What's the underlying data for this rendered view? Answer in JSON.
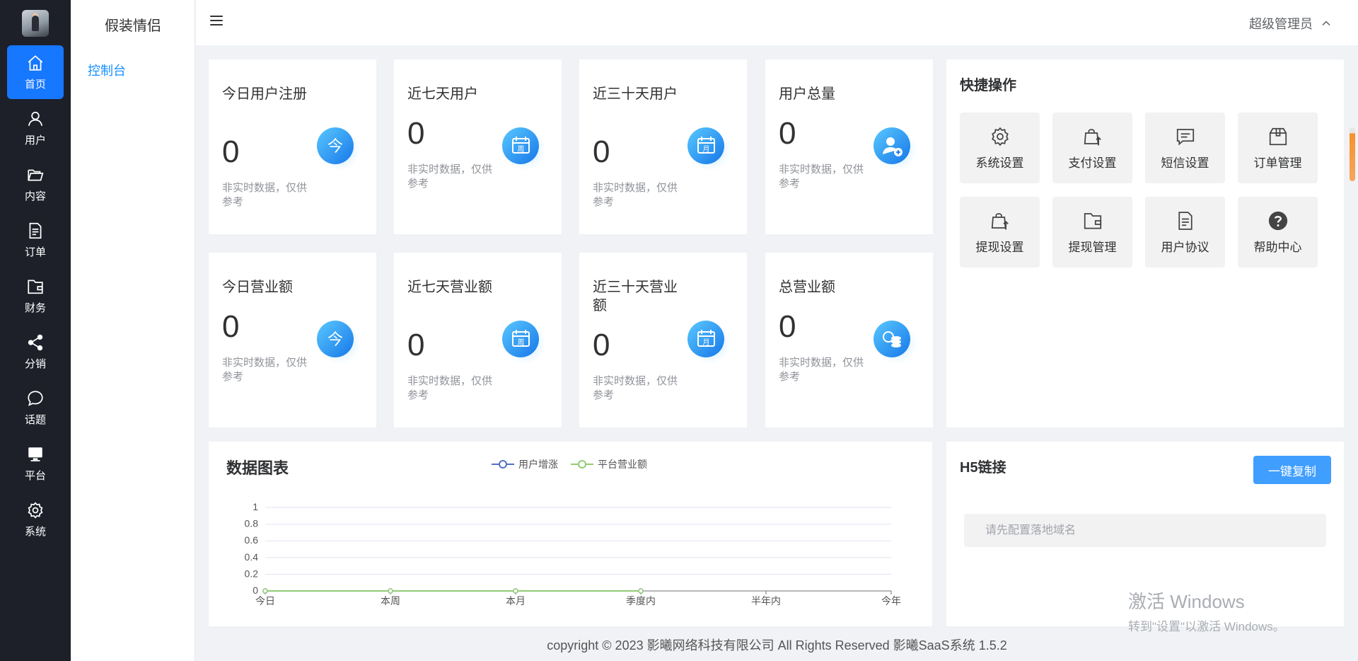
{
  "app": {
    "name": "假装情侣"
  },
  "rail": {
    "items": [
      {
        "label": "首页",
        "icon": "home-icon",
        "active": true
      },
      {
        "label": "用户",
        "icon": "user-icon"
      },
      {
        "label": "内容",
        "icon": "folder-icon"
      },
      {
        "label": "订单",
        "icon": "document-icon"
      },
      {
        "label": "财务",
        "icon": "wallet-icon"
      },
      {
        "label": "分销",
        "icon": "share-icon"
      },
      {
        "label": "话题",
        "icon": "chat-icon"
      },
      {
        "label": "平台",
        "icon": "monitor-icon"
      },
      {
        "label": "系统",
        "icon": "gear-icon"
      }
    ]
  },
  "submenu": {
    "items": [
      {
        "label": "控制台"
      }
    ]
  },
  "header": {
    "user_name": "超级管理员"
  },
  "stats": [
    {
      "title": "今日用户注册",
      "value": "0",
      "note": "非实时数据，仅供参考",
      "icon": "today-icon"
    },
    {
      "title": "近七天用户",
      "value": "0",
      "note": "非实时数据，仅供参考",
      "icon": "week-calendar-icon"
    },
    {
      "title": "近三十天用户",
      "value": "0",
      "note": "非实时数据，仅供参考",
      "icon": "month-calendar-icon"
    },
    {
      "title": "用户总量",
      "value": "0",
      "note": "非实时数据，仅供参考",
      "icon": "add-user-icon"
    },
    {
      "title": "今日营业额",
      "value": "0",
      "note": "非实时数据，仅供参考",
      "icon": "today-icon"
    },
    {
      "title": "近七天营业额",
      "value": "0",
      "note": "非实时数据，仅供参考",
      "icon": "week-calendar-icon"
    },
    {
      "title": "近三十天营业额",
      "value": "0",
      "note": "非实时数据，仅供参考",
      "icon": "month-calendar-icon"
    },
    {
      "title": "总营业额",
      "value": "0",
      "note": "非实时数据，仅供参考",
      "icon": "coins-icon"
    }
  ],
  "quick": {
    "title": "快捷操作",
    "items": [
      {
        "label": "系统设置",
        "icon": "gear-icon"
      },
      {
        "label": "支付设置",
        "icon": "bag-upload-icon"
      },
      {
        "label": "短信设置",
        "icon": "message-icon"
      },
      {
        "label": "订单管理",
        "icon": "box-icon"
      },
      {
        "label": "提现设置",
        "icon": "bag-upload-icon"
      },
      {
        "label": "提现管理",
        "icon": "wallet-icon"
      },
      {
        "label": "用户协议",
        "icon": "document-icon"
      },
      {
        "label": "帮助中心",
        "icon": "help-icon"
      }
    ]
  },
  "chart": {
    "title": "数据图表"
  },
  "chart_data": {
    "type": "line",
    "categories": [
      "今日",
      "本周",
      "本月",
      "季度内",
      "半年内",
      "今年"
    ],
    "series": [
      {
        "name": "用户增涨",
        "color": "#5470c6",
        "values": [
          0,
          0,
          0,
          0,
          null,
          null
        ]
      },
      {
        "name": "平台营业额",
        "color": "#91cc75",
        "values": [
          0,
          0,
          0,
          0,
          null,
          null
        ]
      }
    ],
    "yticks": [
      "1",
      "0.8",
      "0.6",
      "0.4",
      "0.2",
      "0"
    ],
    "ylim": [
      0,
      1
    ],
    "grid": true,
    "legend": "top-center"
  },
  "h5": {
    "title": "H5链接",
    "copy_label": "一键复制",
    "placeholder": "请先配置落地域名"
  },
  "watermark": {
    "line1": "激活 Windows",
    "line2": "转到\"设置\"以激活 Windows。"
  },
  "footer": {
    "text": "copyright © 2023    影曦网络科技有限公司 All Rights Reserved    影曦SaaS系统 1.5.2"
  }
}
